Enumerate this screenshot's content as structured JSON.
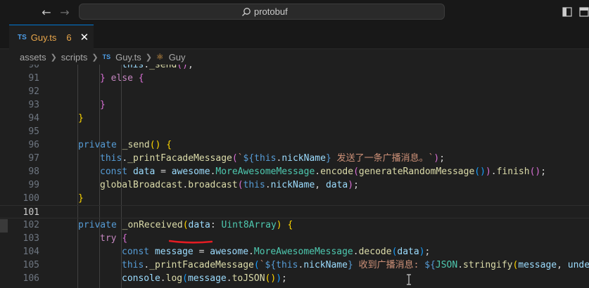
{
  "titlebar": {
    "search_text": "protobuf"
  },
  "tab": {
    "badge": "TS",
    "filename": "Guy.ts",
    "problem_count": "6",
    "close_glyph": "✕"
  },
  "breadcrumb": {
    "items": [
      "assets",
      "scripts",
      "Guy.ts",
      "Guy"
    ],
    "ts_badge": "TS"
  },
  "editor": {
    "active_line": 101,
    "lines": [
      {
        "n": "90",
        "indent": 3,
        "tokens": [
          [
            "var",
            "this"
          ],
          [
            "punc",
            "."
          ],
          [
            "fn",
            "_send"
          ],
          [
            "br2",
            "()"
          ],
          [
            "punc",
            ";"
          ]
        ]
      },
      {
        "n": "91",
        "indent": 2,
        "tokens": [
          [
            "br2",
            "}"
          ],
          [
            "punc",
            " "
          ],
          [
            "ctl",
            "else"
          ],
          [
            "punc",
            " "
          ],
          [
            "br2",
            "{"
          ]
        ]
      },
      {
        "n": "92",
        "indent": 0,
        "tokens": []
      },
      {
        "n": "93",
        "indent": 2,
        "tokens": [
          [
            "br2",
            "}"
          ]
        ]
      },
      {
        "n": "94",
        "indent": 1,
        "tokens": [
          [
            "br1",
            "}"
          ]
        ]
      },
      {
        "n": "95",
        "indent": 0,
        "tokens": []
      },
      {
        "n": "96",
        "indent": 1,
        "tokens": [
          [
            "kw",
            "private"
          ],
          [
            "punc",
            " "
          ],
          [
            "fn",
            "_send"
          ],
          [
            "br1",
            "()"
          ],
          [
            "punc",
            " "
          ],
          [
            "br1",
            "{"
          ]
        ]
      },
      {
        "n": "97",
        "indent": 2,
        "tokens": [
          [
            "kw",
            "this"
          ],
          [
            "punc",
            "."
          ],
          [
            "fn",
            "_printFacadeMessage"
          ],
          [
            "br2",
            "("
          ],
          [
            "str",
            "`"
          ],
          [
            "kw",
            "${"
          ],
          [
            "kw",
            "this"
          ],
          [
            "punc",
            "."
          ],
          [
            "var",
            "nickName"
          ],
          [
            "kw",
            "}"
          ],
          [
            "str",
            " 发送了一条广播消息。`"
          ],
          [
            "br2",
            ")"
          ],
          [
            "punc",
            ";"
          ]
        ]
      },
      {
        "n": "98",
        "indent": 2,
        "tokens": [
          [
            "kw",
            "const"
          ],
          [
            "punc",
            " "
          ],
          [
            "var",
            "data"
          ],
          [
            "punc",
            " = "
          ],
          [
            "var",
            "awesome"
          ],
          [
            "punc",
            "."
          ],
          [
            "cls",
            "MoreAwesomeMessage"
          ],
          [
            "punc",
            "."
          ],
          [
            "fn",
            "encode"
          ],
          [
            "br2",
            "("
          ],
          [
            "fn",
            "generateRandomMessage"
          ],
          [
            "br3",
            "()"
          ],
          [
            "br2",
            ")"
          ],
          [
            "punc",
            "."
          ],
          [
            "fn",
            "finish"
          ],
          [
            "br2",
            "()"
          ],
          [
            "punc",
            ";"
          ]
        ]
      },
      {
        "n": "99",
        "indent": 2,
        "tokens": [
          [
            "fn",
            "globalBroadcast"
          ],
          [
            "punc",
            "."
          ],
          [
            "fn",
            "broadcast"
          ],
          [
            "br2",
            "("
          ],
          [
            "kw",
            "this"
          ],
          [
            "punc",
            "."
          ],
          [
            "var",
            "nickName"
          ],
          [
            "punc",
            ", "
          ],
          [
            "var",
            "data"
          ],
          [
            "br2",
            ")"
          ],
          [
            "punc",
            ";"
          ]
        ]
      },
      {
        "n": "100",
        "indent": 1,
        "tokens": [
          [
            "br1",
            "}"
          ]
        ]
      },
      {
        "n": "101",
        "indent": 0,
        "tokens": []
      },
      {
        "n": "102",
        "indent": 1,
        "tokens": [
          [
            "kw",
            "private"
          ],
          [
            "punc",
            " "
          ],
          [
            "fn",
            "_onReceived"
          ],
          [
            "br1",
            "("
          ],
          [
            "var",
            "data"
          ],
          [
            "punc",
            ": "
          ],
          [
            "cls",
            "Uint8Array"
          ],
          [
            "br1",
            ")"
          ],
          [
            "punc",
            " "
          ],
          [
            "br1",
            "{"
          ]
        ]
      },
      {
        "n": "103",
        "indent": 2,
        "tokens": [
          [
            "ctl",
            "try"
          ],
          [
            "punc",
            " "
          ],
          [
            "br2",
            "{"
          ]
        ]
      },
      {
        "n": "104",
        "indent": 3,
        "tokens": [
          [
            "kw",
            "const"
          ],
          [
            "punc",
            " "
          ],
          [
            "var",
            "message"
          ],
          [
            "punc",
            " = "
          ],
          [
            "var",
            "awesome"
          ],
          [
            "punc",
            "."
          ],
          [
            "cls",
            "MoreAwesomeMessage"
          ],
          [
            "punc",
            "."
          ],
          [
            "fn",
            "decode"
          ],
          [
            "br3",
            "("
          ],
          [
            "var",
            "data"
          ],
          [
            "br3",
            ")"
          ],
          [
            "punc",
            ";"
          ]
        ]
      },
      {
        "n": "105",
        "indent": 3,
        "tokens": [
          [
            "kw",
            "this"
          ],
          [
            "punc",
            "."
          ],
          [
            "fn",
            "_printFacadeMessage"
          ],
          [
            "br3",
            "("
          ],
          [
            "str",
            "`"
          ],
          [
            "kw",
            "${"
          ],
          [
            "kw",
            "this"
          ],
          [
            "punc",
            "."
          ],
          [
            "var",
            "nickName"
          ],
          [
            "kw",
            "}"
          ],
          [
            "str",
            " 收到广播消息: "
          ],
          [
            "kw",
            "${"
          ],
          [
            "cls",
            "JSON"
          ],
          [
            "punc",
            "."
          ],
          [
            "fn",
            "stringify"
          ],
          [
            "br1",
            "("
          ],
          [
            "var",
            "message"
          ],
          [
            "punc",
            ", "
          ],
          [
            "var",
            "undefined"
          ]
        ]
      },
      {
        "n": "106",
        "indent": 3,
        "tokens": [
          [
            "var",
            "console"
          ],
          [
            "punc",
            "."
          ],
          [
            "fn",
            "log"
          ],
          [
            "br3",
            "("
          ],
          [
            "var",
            "message"
          ],
          [
            "punc",
            "."
          ],
          [
            "fn",
            "toJSON"
          ],
          [
            "br1",
            "()"
          ],
          [
            "br3",
            ")"
          ],
          [
            "punc",
            ";"
          ]
        ]
      }
    ]
  },
  "icons": {
    "back": "arrow-left-icon",
    "forward": "arrow-right-icon",
    "search": "search-icon",
    "layout": "layout-icon"
  }
}
